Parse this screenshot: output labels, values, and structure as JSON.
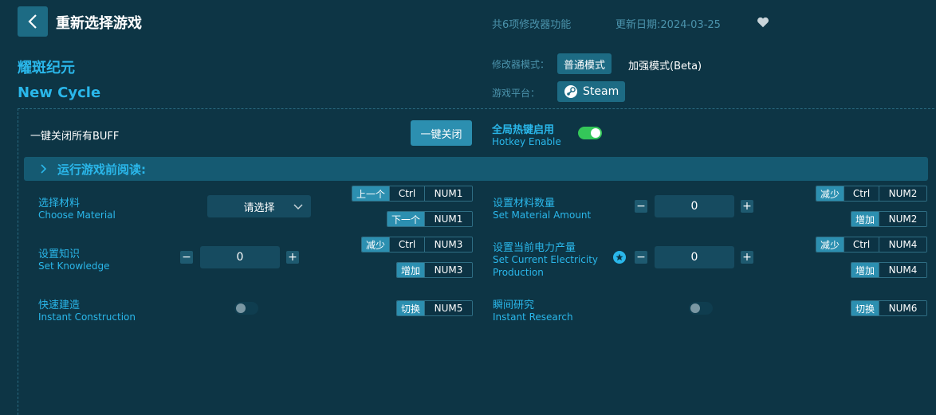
{
  "header": {
    "title": "重新选择游戏",
    "feature_count": "共6项修改器功能",
    "update_date": "更新日期:2024-03-25"
  },
  "game": {
    "name_cn": "耀斑纪元",
    "name_en": "New Cycle"
  },
  "mode": {
    "label": "修改器模式：",
    "normal": "普通模式",
    "beta": "加强模式(Beta)"
  },
  "platform": {
    "label": "游戏平台：",
    "name": "Steam"
  },
  "global": {
    "close_all_label": "一键关闭所有BUFF",
    "close_all_button": "一键关闭",
    "hotkey_cn": "全局热键启用",
    "hotkey_en": "Hotkey Enable"
  },
  "read_bar": {
    "text": "运行游戏前阅读:"
  },
  "options": {
    "choose_material": {
      "cn": "选择材料",
      "en": "Choose Material",
      "select_placeholder": "请选择",
      "prev_tag": "上一个",
      "next_tag": "下一个",
      "key_mod": "Ctrl",
      "key_prev": "NUM1",
      "key_next": "NUM1"
    },
    "set_material_amount": {
      "cn": "设置材料数量",
      "en": "Set Material Amount",
      "value": "0",
      "dec_tag": "减少",
      "inc_tag": "增加",
      "key_mod": "Ctrl",
      "key_dec": "NUM2",
      "key_inc": "NUM2"
    },
    "set_knowledge": {
      "cn": "设置知识",
      "en": "Set Knowledge",
      "value": "0",
      "dec_tag": "减少",
      "inc_tag": "增加",
      "key_mod": "Ctrl",
      "key_dec": "NUM3",
      "key_inc": "NUM3"
    },
    "set_electricity": {
      "cn": "设置当前电力产量",
      "en_line1": "Set Current Electricity",
      "en_line2": "Production",
      "value": "0",
      "dec_tag": "减少",
      "inc_tag": "增加",
      "key_mod": "Ctrl",
      "key_dec": "NUM4",
      "key_inc": "NUM4"
    },
    "instant_construction": {
      "cn": "快速建造",
      "en": "Instant Construction",
      "toggle_tag": "切换",
      "key": "NUM5"
    },
    "instant_research": {
      "cn": "瞬间研究",
      "en": "Instant Research",
      "toggle_tag": "切换",
      "key": "NUM6"
    }
  },
  "icons": {
    "back": "chevron-left-icon",
    "favorite": "heart-icon",
    "platform": "steam-icon",
    "read_bar": "chevron-right-icon",
    "dropdown": "chevron-down-icon",
    "info": "star-icon"
  },
  "colors": {
    "background": "#0d3545",
    "accent": "#2ab7ea",
    "button": "#1d6b84",
    "toggle_on": "#34c759"
  }
}
